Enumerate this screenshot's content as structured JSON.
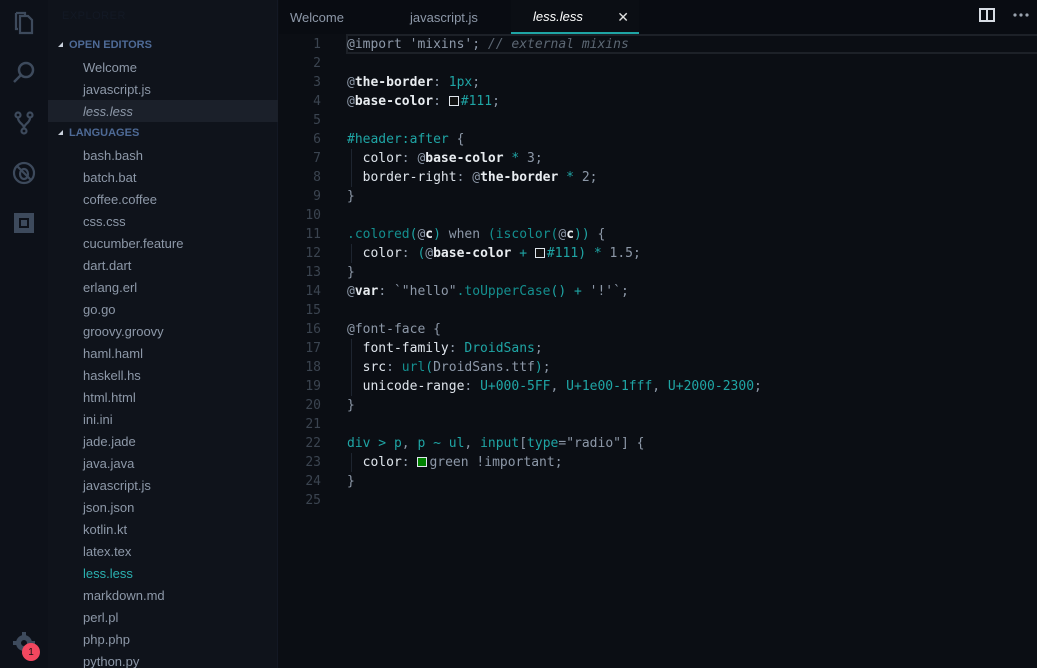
{
  "activity_bar": {
    "icons": [
      "files-icon",
      "search-icon",
      "source-control-icon",
      "debug-icon",
      "extensions-icon"
    ],
    "settings_badge": "1"
  },
  "sidebar": {
    "title": "EXPLORER",
    "open_editors": {
      "label": "OPEN EDITORS",
      "items": [
        {
          "label": "Welcome"
        },
        {
          "label": "javascript.js"
        },
        {
          "label": "less.less"
        }
      ]
    },
    "languages": {
      "label": "LANGUAGES",
      "items": [
        {
          "label": "bash.bash"
        },
        {
          "label": "batch.bat"
        },
        {
          "label": "coffee.coffee"
        },
        {
          "label": "css.css"
        },
        {
          "label": "cucumber.feature"
        },
        {
          "label": "dart.dart"
        },
        {
          "label": "erlang.erl"
        },
        {
          "label": "go.go"
        },
        {
          "label": "groovy.groovy"
        },
        {
          "label": "haml.haml"
        },
        {
          "label": "haskell.hs"
        },
        {
          "label": "html.html"
        },
        {
          "label": "ini.ini"
        },
        {
          "label": "jade.jade"
        },
        {
          "label": "java.java"
        },
        {
          "label": "javascript.js"
        },
        {
          "label": "json.json"
        },
        {
          "label": "kotlin.kt"
        },
        {
          "label": "latex.tex"
        },
        {
          "label": "less.less"
        },
        {
          "label": "markdown.md"
        },
        {
          "label": "perl.pl"
        },
        {
          "label": "php.php"
        },
        {
          "label": "python.py"
        }
      ]
    }
  },
  "tabs": [
    {
      "label": "Welcome"
    },
    {
      "label": "javascript.js"
    },
    {
      "label": "less.less",
      "close": "✕"
    }
  ],
  "colors": {
    "accent": "#1fa5a5",
    "badge": "#f2475f",
    "swatch_111": "#111111",
    "swatch_green": "#008000"
  },
  "editor": {
    "line_numbers": [
      "1",
      "2",
      "3",
      "4",
      "5",
      "6",
      "7",
      "8",
      "9",
      "10",
      "11",
      "12",
      "13",
      "14",
      "15",
      "16",
      "17",
      "18",
      "19",
      "20",
      "21",
      "22",
      "23",
      "24",
      "25"
    ],
    "lines": [
      [
        {
          "t": "@import ",
          "c": "c-at"
        },
        {
          "t": "'mixins'",
          "c": "c-str"
        },
        {
          "t": "; ",
          "c": "c-punc"
        },
        {
          "t": "// external mixins",
          "c": "c-com"
        }
      ],
      [],
      [
        {
          "t": "@",
          "c": "c-at"
        },
        {
          "t": "the-border",
          "c": "c-var"
        },
        {
          "t": ": ",
          "c": "c-punc"
        },
        {
          "t": "1px",
          "c": "c-num"
        },
        {
          "t": ";",
          "c": "c-punc"
        }
      ],
      [
        {
          "t": "@",
          "c": "c-at"
        },
        {
          "t": "base-color",
          "c": "c-var"
        },
        {
          "t": ": ",
          "c": "c-punc"
        },
        {
          "swatch": "#111111"
        },
        {
          "t": "#111",
          "c": "c-num"
        },
        {
          "t": ";",
          "c": "c-punc"
        }
      ],
      [],
      [
        {
          "t": "#header:after",
          "c": "c-sel"
        },
        {
          "t": " {",
          "c": "c-punc"
        }
      ],
      [
        {
          "t": "  "
        },
        {
          "t": "color",
          "c": "c-prop"
        },
        {
          "t": ": ",
          "c": "c-punc"
        },
        {
          "t": "@",
          "c": "c-at"
        },
        {
          "t": "base-color",
          "c": "c-var"
        },
        {
          "t": " * ",
          "c": "c-op"
        },
        {
          "t": "3",
          "c": "c-punc"
        },
        {
          "t": ";",
          "c": "c-punc"
        }
      ],
      [
        {
          "t": "  "
        },
        {
          "t": "border-right",
          "c": "c-prop"
        },
        {
          "t": ": ",
          "c": "c-punc"
        },
        {
          "t": "@",
          "c": "c-at"
        },
        {
          "t": "the-border",
          "c": "c-var"
        },
        {
          "t": " * ",
          "c": "c-op"
        },
        {
          "t": "2",
          "c": "c-punc"
        },
        {
          "t": ";",
          "c": "c-punc"
        }
      ],
      [
        {
          "t": "}",
          "c": "c-punc"
        }
      ],
      [],
      [
        {
          "t": ".colored",
          "c": "c-fn"
        },
        {
          "t": "(",
          "c": "c-op"
        },
        {
          "t": "@",
          "c": "c-at"
        },
        {
          "t": "c",
          "c": "c-var"
        },
        {
          "t": ")",
          "c": "c-op"
        },
        {
          "t": " when ",
          "c": "c-kw"
        },
        {
          "t": "(iscolor(",
          "c": "c-fn"
        },
        {
          "t": "@",
          "c": "c-at"
        },
        {
          "t": "c",
          "c": "c-var"
        },
        {
          "t": "))",
          "c": "c-op"
        },
        {
          "t": " {",
          "c": "c-punc"
        }
      ],
      [
        {
          "t": "  "
        },
        {
          "t": "color",
          "c": "c-prop"
        },
        {
          "t": ": ",
          "c": "c-punc"
        },
        {
          "t": "(",
          "c": "c-op"
        },
        {
          "t": "@",
          "c": "c-at"
        },
        {
          "t": "base-color",
          "c": "c-var"
        },
        {
          "t": " + ",
          "c": "c-op"
        },
        {
          "swatch": "#111111"
        },
        {
          "t": "#111",
          "c": "c-num"
        },
        {
          "t": ")",
          "c": "c-op"
        },
        {
          "t": " * ",
          "c": "c-op"
        },
        {
          "t": "1.5",
          "c": "c-punc"
        },
        {
          "t": ";",
          "c": "c-punc"
        }
      ],
      [
        {
          "t": "}",
          "c": "c-punc"
        }
      ],
      [
        {
          "t": "@",
          "c": "c-at"
        },
        {
          "t": "var",
          "c": "c-var"
        },
        {
          "t": ": ",
          "c": "c-punc"
        },
        {
          "t": "`\"hello\"",
          "c": "c-str"
        },
        {
          "t": ".toUpperCase",
          "c": "c-fn"
        },
        {
          "t": "()",
          "c": "c-op"
        },
        {
          "t": " + ",
          "c": "c-op"
        },
        {
          "t": "'!'`",
          "c": "c-str"
        },
        {
          "t": ";",
          "c": "c-punc"
        }
      ],
      [],
      [
        {
          "t": "@font-face",
          "c": "c-at"
        },
        {
          "t": " {",
          "c": "c-punc"
        }
      ],
      [
        {
          "t": "  "
        },
        {
          "t": "font-family",
          "c": "c-prop"
        },
        {
          "t": ": ",
          "c": "c-punc"
        },
        {
          "t": "DroidSans",
          "c": "c-num"
        },
        {
          "t": ";",
          "c": "c-punc"
        }
      ],
      [
        {
          "t": "  "
        },
        {
          "t": "src",
          "c": "c-prop"
        },
        {
          "t": ": ",
          "c": "c-punc"
        },
        {
          "t": "url",
          "c": "c-fn"
        },
        {
          "t": "(",
          "c": "c-op"
        },
        {
          "t": "DroidSans.ttf",
          "c": "c-str"
        },
        {
          "t": ")",
          "c": "c-op"
        },
        {
          "t": ";",
          "c": "c-punc"
        }
      ],
      [
        {
          "t": "  "
        },
        {
          "t": "unicode-range",
          "c": "c-prop"
        },
        {
          "t": ": ",
          "c": "c-punc"
        },
        {
          "t": "U+000-5FF",
          "c": "c-num"
        },
        {
          "t": ", ",
          "c": "c-punc"
        },
        {
          "t": "U+1e00-1fff",
          "c": "c-num"
        },
        {
          "t": ", ",
          "c": "c-punc"
        },
        {
          "t": "U+2000-2300",
          "c": "c-num"
        },
        {
          "t": ";",
          "c": "c-punc"
        }
      ],
      [
        {
          "t": "}",
          "c": "c-punc"
        }
      ],
      [],
      [
        {
          "t": "div",
          "c": "c-sel"
        },
        {
          "t": " > ",
          "c": "c-op"
        },
        {
          "t": "p",
          "c": "c-sel"
        },
        {
          "t": ", ",
          "c": "c-punc"
        },
        {
          "t": "p",
          "c": "c-sel"
        },
        {
          "t": " ~ ",
          "c": "c-op"
        },
        {
          "t": "ul",
          "c": "c-sel"
        },
        {
          "t": ", ",
          "c": "c-punc"
        },
        {
          "t": "input",
          "c": "c-sel"
        },
        {
          "t": "[",
          "c": "c-punc"
        },
        {
          "t": "type",
          "c": "c-sel"
        },
        {
          "t": "=",
          "c": "c-punc"
        },
        {
          "t": "\"radio\"",
          "c": "c-str"
        },
        {
          "t": "] {",
          "c": "c-punc"
        }
      ],
      [
        {
          "t": "  "
        },
        {
          "t": "color",
          "c": "c-prop"
        },
        {
          "t": ": ",
          "c": "c-punc"
        },
        {
          "swatch": "#008000"
        },
        {
          "t": "green !important",
          "c": "c-str"
        },
        {
          "t": ";",
          "c": "c-punc"
        }
      ],
      [
        {
          "t": "}",
          "c": "c-punc"
        }
      ],
      []
    ]
  }
}
